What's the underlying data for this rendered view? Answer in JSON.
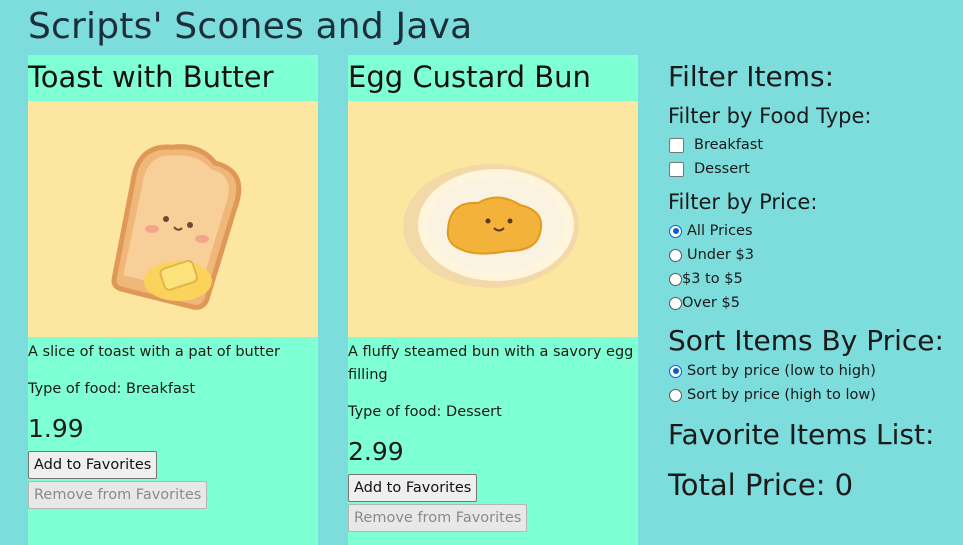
{
  "page": {
    "title": "Scripts' Scones and Java"
  },
  "items": [
    {
      "name": "Toast with Butter",
      "description": "A slice of toast with a pat of butter",
      "type_label": "Type of food: Breakfast",
      "price": "1.99",
      "add_label": "Add to Favorites",
      "remove_label": "Remove from Favorites",
      "image_icon": "toast-with-butter-icon"
    },
    {
      "name": "Egg Custard Bun",
      "description": "A fluffy steamed bun with a savory egg filling",
      "type_label": "Type of food: Dessert",
      "price": "2.99",
      "add_label": "Add to Favorites",
      "remove_label": "Remove from Favorites",
      "image_icon": "egg-custard-bun-icon"
    }
  ],
  "sidebar": {
    "filter_heading": "Filter Items:",
    "food_type_heading": "Filter by Food Type:",
    "food_types": [
      {
        "label": "Breakfast",
        "checked": false
      },
      {
        "label": "Dessert",
        "checked": false
      }
    ],
    "price_heading": "Filter by Price:",
    "price_options": [
      {
        "label": "All Prices",
        "checked": true
      },
      {
        "label": "Under $3",
        "checked": false
      },
      {
        "label": "$3 to $5",
        "checked": false
      },
      {
        "label": "Over $5",
        "checked": false
      }
    ],
    "sort_heading": "Sort Items By Price:",
    "sort_options": [
      {
        "label": "Sort by price (low to high)",
        "checked": true
      },
      {
        "label": "Sort by price (high to low)",
        "checked": false
      }
    ],
    "favorites_heading": "Favorite Items List:",
    "total_label": "Total Price: 0"
  },
  "colors": {
    "background": "#7ddcdc",
    "card": "#7fffd4",
    "image_bg": "#fde7a0",
    "radio_accent": "#0a5fd0"
  }
}
